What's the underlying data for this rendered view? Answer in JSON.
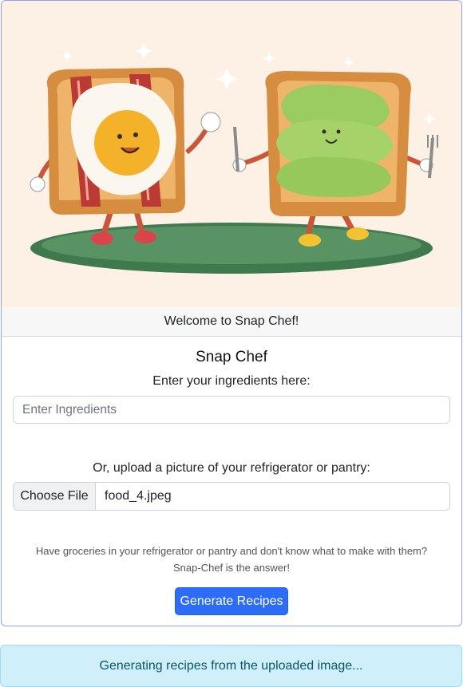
{
  "card": {
    "header": "Welcome to Snap Chef!",
    "title": "Snap Chef",
    "ingredients_label": "Enter your ingredients here:",
    "ingredients_input": {
      "value": "",
      "placeholder": "Enter Ingredients"
    },
    "upload_label": "Or, upload a picture of your refrigerator or pantry:",
    "file_input": {
      "button_label": "Choose File",
      "file_name": "food_4.jpeg"
    },
    "description_line1": "Have groceries in your refrigerator or pantry and don't know what to make with them?",
    "description_line2": "Snap-Chef is the answer!",
    "generate_button": "Generate Recipes"
  },
  "alert": {
    "text": "Generating recipes from the uploaded image..."
  },
  "colors": {
    "hero_background": "#fdf1e6",
    "primary_button": "#2c6cf6",
    "alert_background": "#cff0fa",
    "card_border": "#8ea2f5"
  },
  "hero": {
    "characters": [
      "bacon-egg-toast-character",
      "avocado-toast-character"
    ]
  }
}
